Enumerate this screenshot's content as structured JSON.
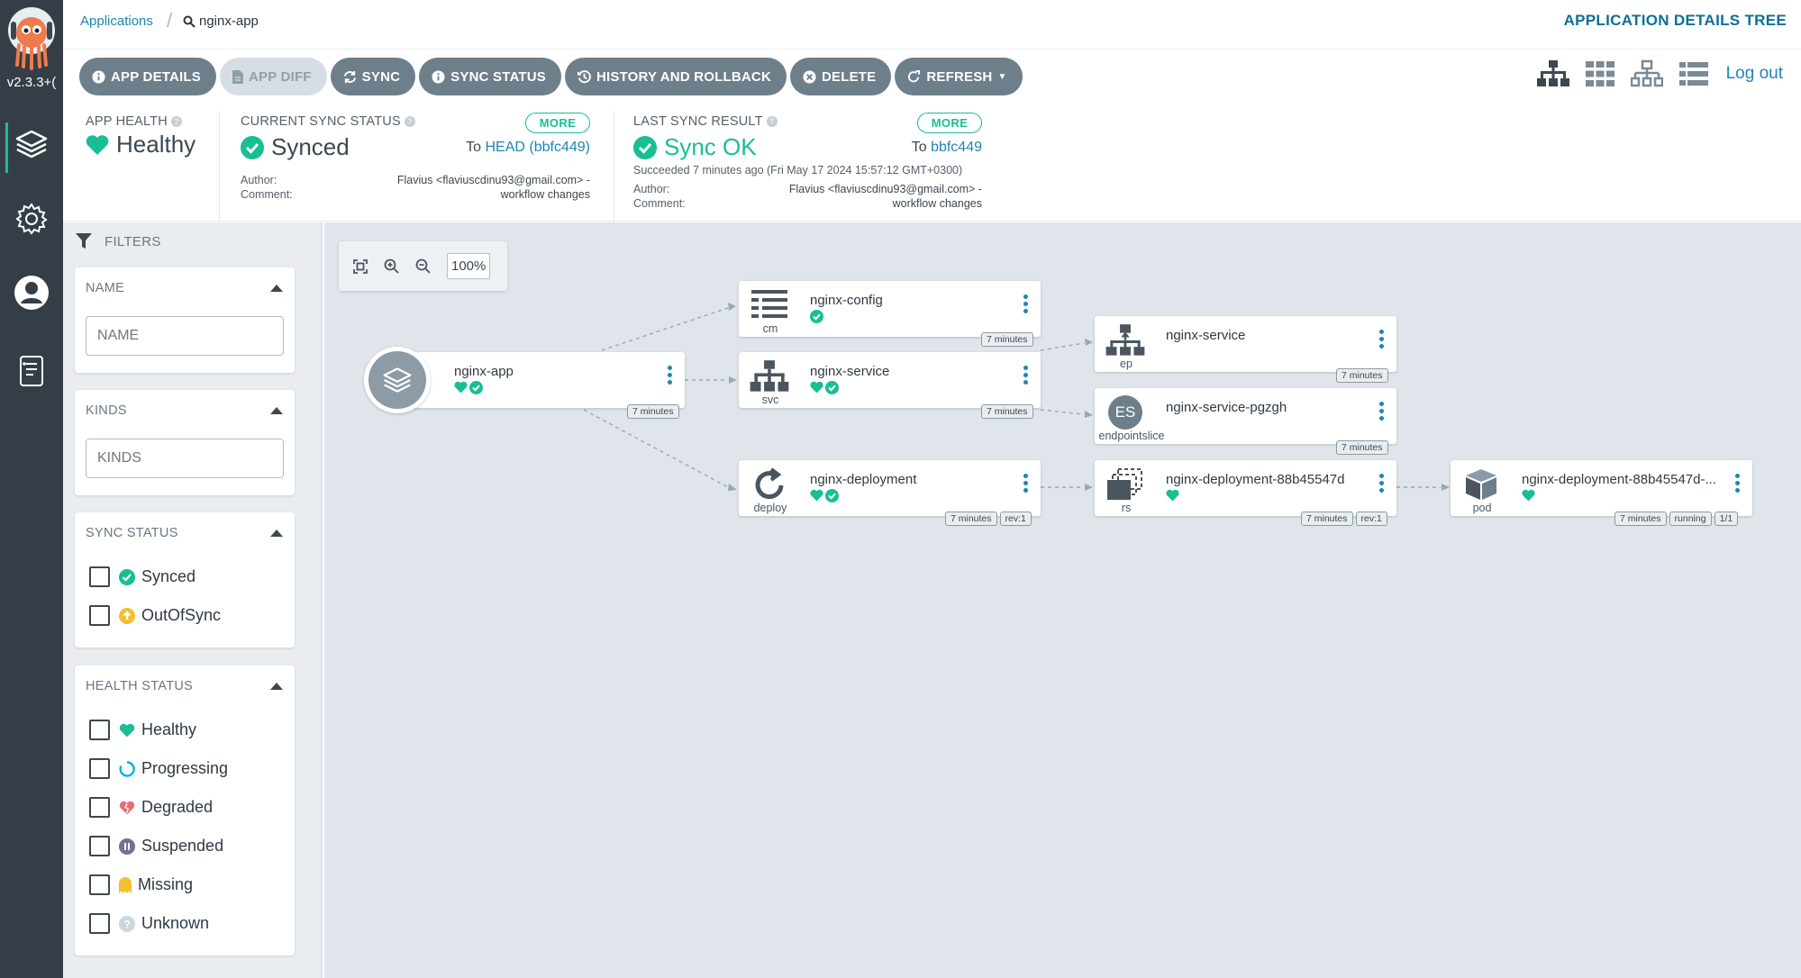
{
  "sidebar": {
    "version": "v2.3.3+(",
    "items": [
      {
        "name": "applications",
        "active": true
      },
      {
        "name": "settings",
        "active": false
      },
      {
        "name": "user-info",
        "active": false
      },
      {
        "name": "docs",
        "active": false
      }
    ]
  },
  "breadcrumb": {
    "link": "Applications",
    "current": "nginx-app"
  },
  "page_title": "APPLICATION DETAILS TREE",
  "toolbar": {
    "app_details": "APP DETAILS",
    "app_diff": "APP DIFF",
    "sync": "SYNC",
    "sync_status": "SYNC STATUS",
    "history": "HISTORY AND ROLLBACK",
    "delete": "DELETE",
    "refresh": "REFRESH"
  },
  "logout": "Log out",
  "status": {
    "health_label": "APP HEALTH",
    "health_value": "Healthy",
    "sync_label": "CURRENT SYNC STATUS",
    "sync_value": "Synced",
    "more": "MORE",
    "sync_to": "To",
    "sync_to_link": "HEAD (bbfc449)",
    "author_label": "Author:",
    "comment_label": "Comment:",
    "sync_author": "Flavius <flaviuscdinu93@gmail.com> -",
    "sync_comment": "workflow changes",
    "last_label": "LAST SYNC RESULT",
    "last_value": "Sync OK",
    "last_to": "To",
    "last_to_link": "bbfc449",
    "last_succeeded": "Succeeded 7 minutes ago (Fri May 17 2024 15:57:12 GMT+0300)",
    "last_author": "Flavius <flaviuscdinu93@gmail.com> -",
    "last_comment": "workflow changes"
  },
  "filters": {
    "title": "FILTERS",
    "name_header": "NAME",
    "name_placeholder": "NAME",
    "kinds_header": "KINDS",
    "kinds_placeholder": "KINDS",
    "sync_header": "SYNC STATUS",
    "sync_options": [
      "Synced",
      "OutOfSync"
    ],
    "health_header": "HEALTH STATUS",
    "health_options": [
      "Healthy",
      "Progressing",
      "Degraded",
      "Suspended",
      "Missing",
      "Unknown"
    ]
  },
  "zoom": "100%",
  "nodes": {
    "app": {
      "name": "nginx-app",
      "age": "7 minutes"
    },
    "cm": {
      "name": "nginx-config",
      "kind": "cm",
      "age": "7 minutes"
    },
    "svc": {
      "name": "nginx-service",
      "kind": "svc",
      "age": "7 minutes"
    },
    "deploy": {
      "name": "nginx-deployment",
      "kind": "deploy",
      "age": "7 minutes",
      "rev": "rev:1"
    },
    "ep": {
      "name": "nginx-service",
      "kind": "ep",
      "age": "7 minutes"
    },
    "es": {
      "name": "nginx-service-pgzgh",
      "kind": "endpointslice",
      "glyph": "ES",
      "age": "7 minutes"
    },
    "rs": {
      "name": "nginx-deployment-88b45547d",
      "kind": "rs",
      "age": "7 minutes",
      "rev": "rev:1"
    },
    "pod": {
      "name": "nginx-deployment-88b45547d-...",
      "kind": "pod",
      "age": "7 minutes",
      "state": "running",
      "ready": "1/1"
    }
  },
  "colors": {
    "healthy": "#18be94",
    "link": "#1e86b2",
    "outofsync": "#f4c030",
    "degraded": "#e96d76",
    "button": "#6d7f8b"
  }
}
